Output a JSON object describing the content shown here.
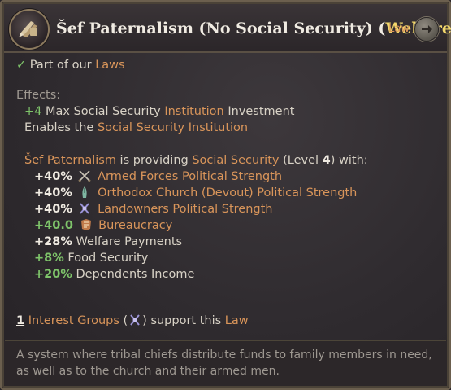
{
  "header": {
    "title_name": "Šef Paternalism (No Social Security) (",
    "title_group": "Welfare",
    "title_close": ")",
    "law_link": "Law"
  },
  "status": {
    "text": "Part of our ",
    "link": "Laws"
  },
  "effects": {
    "label": "Effects:",
    "line1": {
      "value": "+4",
      "text1": " Max Social Security ",
      "link": "Institution",
      "text2": " Investment"
    },
    "line2": {
      "text1": "Enables the ",
      "link1": "Social Security",
      "text2": " ",
      "link2": "Institution"
    }
  },
  "providing": {
    "subject": "Šef Paternalism",
    "text1": " is providing ",
    "link": "Social Security",
    "text2": " (Level ",
    "level": "4",
    "text3": ") with:"
  },
  "modifiers": [
    {
      "value": "+40%",
      "icon": "crossed-swords-icon",
      "name": "Armed Forces",
      "suffix": "Political Strength"
    },
    {
      "value": "+40%",
      "icon": "church-icon",
      "name": "Orthodox Church (Devout)",
      "suffix": "Political Strength"
    },
    {
      "value": "+40%",
      "icon": "wheat-icon",
      "name": "Landowners",
      "suffix": "Political Strength"
    },
    {
      "value": "+40.0",
      "icon": "bureaucracy-icon",
      "name": "Bureaucracy",
      "suffix": ""
    },
    {
      "value": "+28%",
      "name": "Welfare Payments"
    },
    {
      "value": "+8%",
      "name": "Food Security"
    },
    {
      "value": "+20%",
      "name": "Dependents Income"
    }
  ],
  "support": {
    "count": "1",
    "link": "Interest Groups",
    "paren_open": " (",
    "paren_close": ") support this ",
    "law_link": "Law",
    "icon": "wheat-icon"
  },
  "description": "A system where tribal chiefs distribute funds to family members in need, as well as to the church and their armed men.",
  "colors": {
    "accent_orange": "#d9955a",
    "positive_green": "#7ec46a",
    "title_yellow": "#f2d76b"
  }
}
